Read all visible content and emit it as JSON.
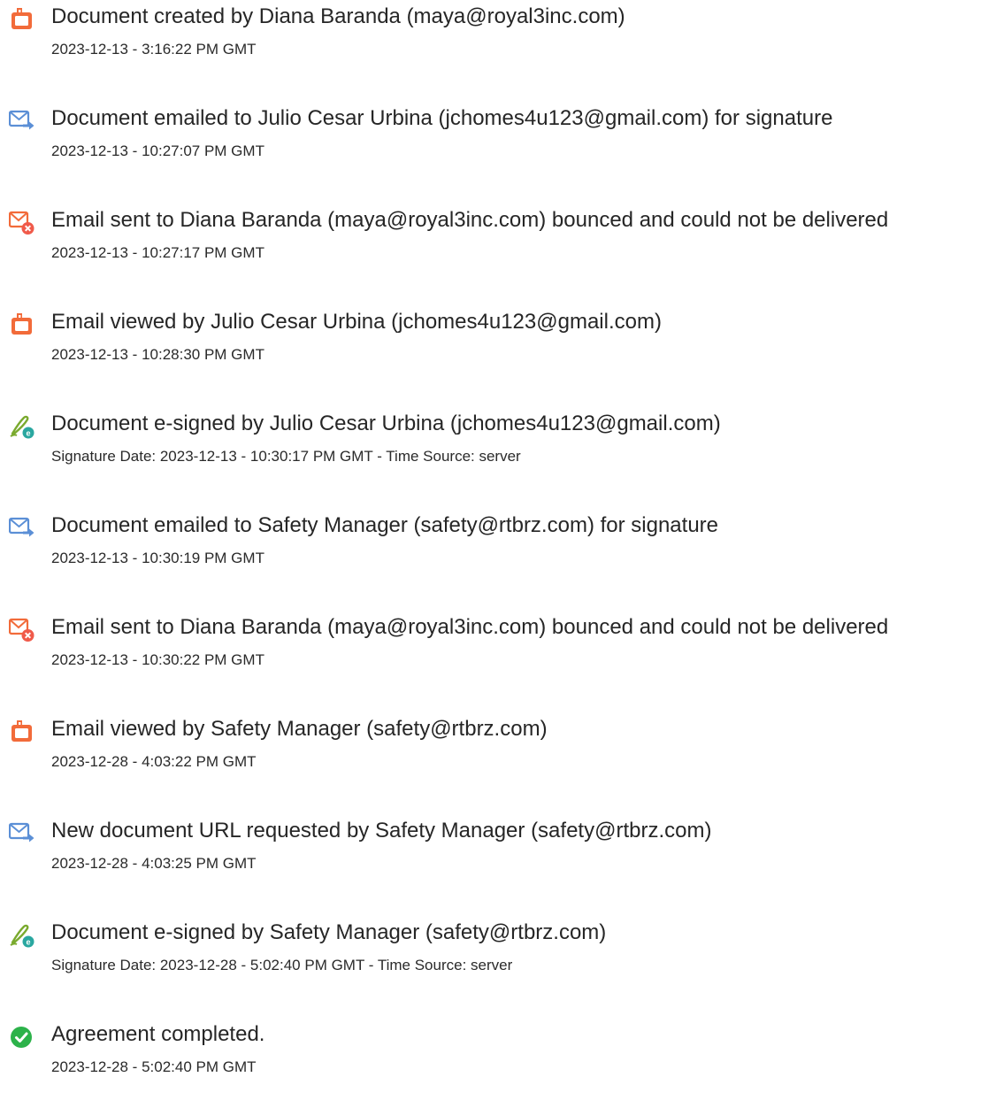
{
  "events": [
    {
      "icon": "document-created-icon",
      "title": "Document created by Diana Baranda (maya@royal3inc.com)",
      "meta": "2023-12-13 - 3:16:22 PM GMT"
    },
    {
      "icon": "email-sent-icon",
      "title": "Document emailed to Julio Cesar Urbina (jchomes4u123@gmail.com) for signature",
      "meta": "2023-12-13 - 10:27:07 PM GMT"
    },
    {
      "icon": "email-bounced-icon",
      "title": "Email sent to Diana Baranda (maya@royal3inc.com) bounced and could not be delivered",
      "meta": "2023-12-13 - 10:27:17 PM GMT"
    },
    {
      "icon": "document-viewed-icon",
      "title": "Email viewed by Julio Cesar Urbina (jchomes4u123@gmail.com)",
      "meta": "2023-12-13 - 10:28:30 PM GMT"
    },
    {
      "icon": "e-sign-icon",
      "title": "Document e-signed by Julio Cesar Urbina (jchomes4u123@gmail.com)",
      "meta": "Signature Date: 2023-12-13 - 10:30:17 PM GMT - Time Source: server"
    },
    {
      "icon": "email-sent-icon",
      "title": "Document emailed to Safety Manager (safety@rtbrz.com) for signature",
      "meta": "2023-12-13 - 10:30:19 PM GMT"
    },
    {
      "icon": "email-bounced-icon",
      "title": "Email sent to Diana Baranda (maya@royal3inc.com) bounced and could not be delivered",
      "meta": "2023-12-13 - 10:30:22 PM GMT"
    },
    {
      "icon": "document-viewed-icon",
      "title": "Email viewed by Safety Manager (safety@rtbrz.com)",
      "meta": "2023-12-28 - 4:03:22 PM GMT"
    },
    {
      "icon": "email-sent-icon",
      "title": "New document URL requested by Safety Manager (safety@rtbrz.com)",
      "meta": "2023-12-28 - 4:03:25 PM GMT"
    },
    {
      "icon": "e-sign-icon",
      "title": "Document e-signed by Safety Manager (safety@rtbrz.com)",
      "meta": "Signature Date: 2023-12-28 - 5:02:40 PM GMT - Time Source: server"
    },
    {
      "icon": "completed-check-icon",
      "title": "Agreement completed.",
      "meta": "2023-12-28 - 5:02:40 PM GMT"
    }
  ],
  "colors": {
    "document_icon": "#f26b3a",
    "email_icon": "#5b8fd6",
    "bounce_badge": "#f05a4a",
    "esign_pen": "#7aaa2e",
    "esign_badge": "#2aa7a0",
    "completed": "#2cb24a"
  }
}
